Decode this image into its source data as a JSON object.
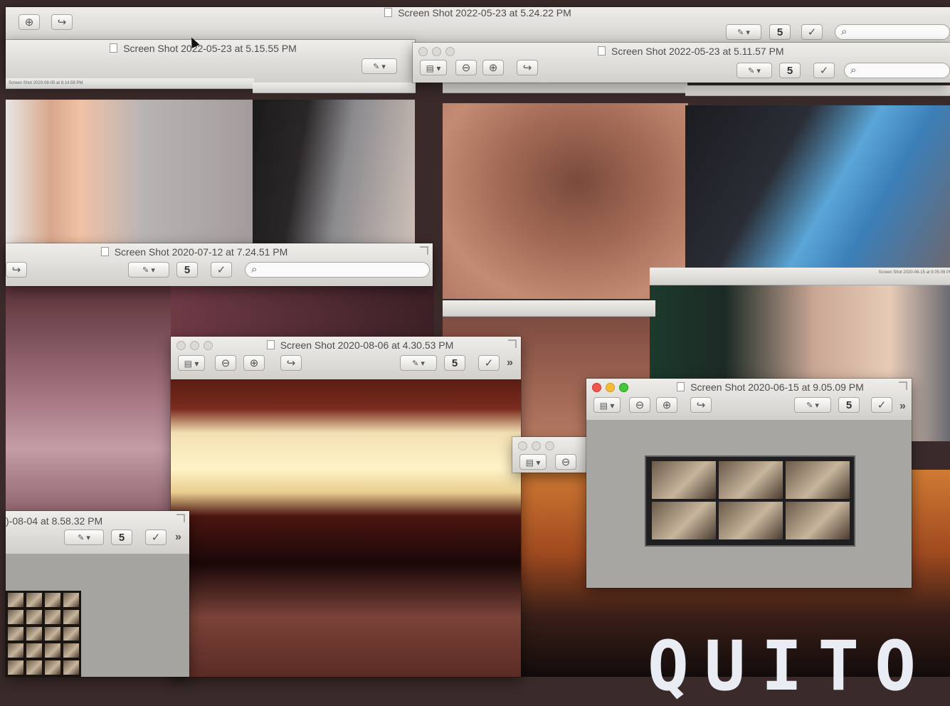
{
  "desktop": {
    "top_window_title": "Screen Shot 2022-05-23 at 5.24.22 PM",
    "window_b_title": "Screen Shot 2022-05-23 at 5.15.55 PM",
    "window_c_title": "Screen Shot 2022-05-23 at 5.11.57 PM",
    "window_d_title": "Screen Shot 2020-07-12 at 7.24.51 PM",
    "window_e_title": "Screen Shot 2020-08-06 at 4.30.53 PM",
    "window_f_title": "Screen Shot 2020-06-15 at 9.05.09 PM",
    "window_g_title": ")-08-04 at 8.58.32 PM",
    "tiny_title_1": "Screen Shot 2020-08-05 at 8.14.59 PM",
    "tiny_title_2": "Screen Shot 2020-06-15 at 9.05.09 PM",
    "bottom_text": "QUITO"
  },
  "toolbar": {
    "zoom_out": "⊖",
    "zoom_in": "⊕",
    "share": "↪",
    "markup": "✎ ▾",
    "rotate": "5",
    "edit": "✓",
    "search": "⌕",
    "sidebar": "▤ ▾",
    "more": "»"
  }
}
